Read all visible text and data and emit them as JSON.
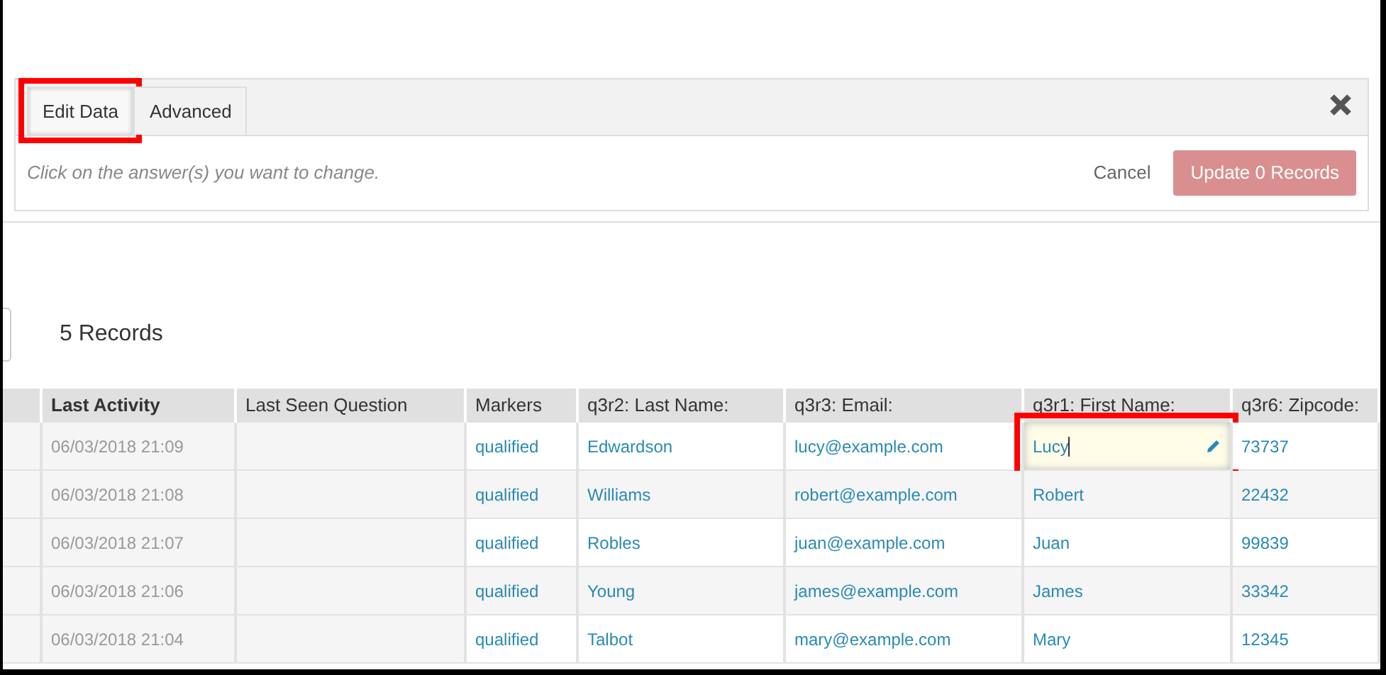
{
  "tabs": [
    {
      "label": "Edit Data",
      "selected": true,
      "highlighted": true
    },
    {
      "label": "Advanced",
      "selected": false,
      "highlighted": false
    }
  ],
  "hint": "Click on the answer(s) you want to change.",
  "cancel": "Cancel",
  "update_button": "Update 0 Records",
  "record_count": "5 Records",
  "table": {
    "columns": [
      "Last Activity",
      "Last Seen Question",
      "Markers",
      "q3r2: Last Name:",
      "q3r3: Email:",
      "q3r1: First Name:",
      "q3r6: Zipcode:"
    ],
    "rows": [
      {
        "last_activity": "06/03/2018 21:09",
        "markers": "qualified",
        "last_name": "Edwardson",
        "email": "lucy@example.com",
        "first_name": "Lucy",
        "zipcode": "73737",
        "editing": true
      },
      {
        "last_activity": "06/03/2018 21:08",
        "markers": "qualified",
        "last_name": "Williams",
        "email": "robert@example.com",
        "first_name": "Robert",
        "zipcode": "22432",
        "editing": false
      },
      {
        "last_activity": "06/03/2018 21:07",
        "markers": "qualified",
        "last_name": "Robles",
        "email": "juan@example.com",
        "first_name": "Juan",
        "zipcode": "99839",
        "editing": false
      },
      {
        "last_activity": "06/03/2018 21:06",
        "markers": "qualified",
        "last_name": "Young",
        "email": "james@example.com",
        "first_name": "James",
        "zipcode": "33342",
        "editing": false
      },
      {
        "last_activity": "06/03/2018 21:04",
        "markers": "qualified",
        "last_name": "Talbot",
        "email": "mary@example.com",
        "first_name": "Mary",
        "zipcode": "12345",
        "editing": false
      }
    ]
  }
}
